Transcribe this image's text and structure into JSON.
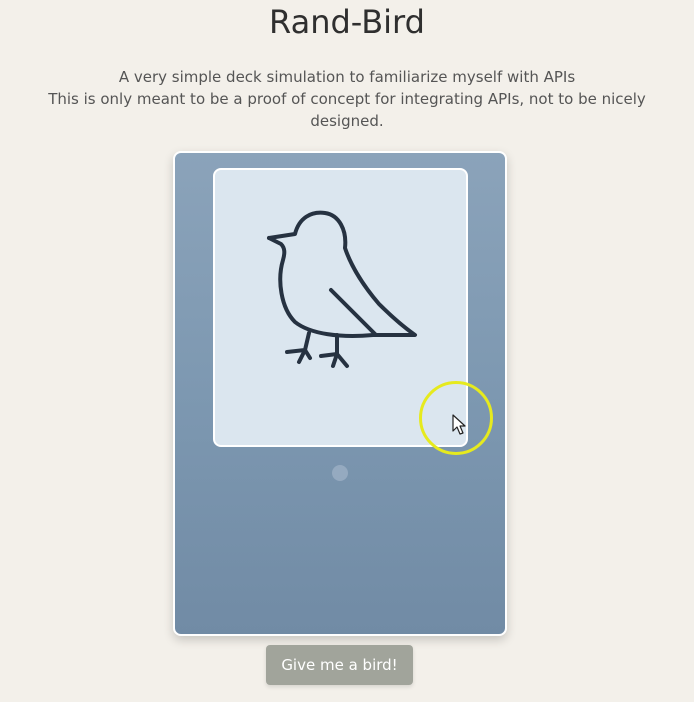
{
  "header": {
    "title": "Rand-Bird",
    "description_line1": "A very simple deck simulation to familiarize myself with APIs",
    "description_line2": "This is only meant to be a proof of concept for integrating APIs, not to be nicely designed."
  },
  "card": {
    "icon": "bird-icon",
    "indicator_icon": "dot"
  },
  "actions": {
    "give_bird_label": "Give me a bird!"
  },
  "overlay": {
    "cursor_icon": "mouse-pointer-icon",
    "highlight_color": "#e6ea1e"
  },
  "colors": {
    "background": "#f3f0ea",
    "card_top": "#8ba3ba",
    "card_bottom": "#718ba5",
    "image_bg": "#dbe6ef",
    "button_bg": "#a1a49b"
  }
}
